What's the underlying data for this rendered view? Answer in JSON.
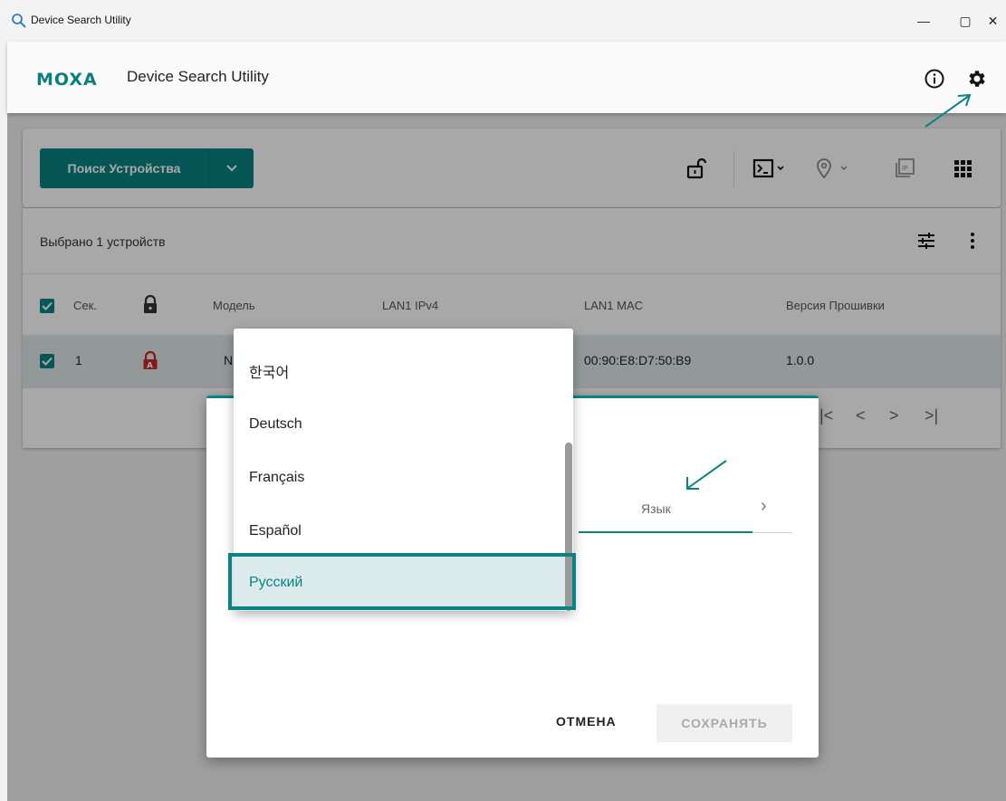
{
  "window": {
    "title": "Device Search Utility",
    "controls": {
      "minimize": "—",
      "maximize": "▢",
      "close": "✕"
    }
  },
  "header": {
    "logo": "MOXA",
    "title": "Device Search Utility"
  },
  "toolbar": {
    "search_label": "Поиск Устройства"
  },
  "table": {
    "selected_text": "Выбрано 1 устройств",
    "columns": [
      "Сек.",
      "Модель",
      "LAN1 IPv4",
      "LAN1 MAC",
      "Версия Прошивки"
    ],
    "rows": [
      {
        "sec": "1",
        "model": "N",
        "mac": "00:90:E8:D7:50:B9",
        "firmware": "1.0.0"
      }
    ],
    "pager": [
      "|<",
      "<",
      ">",
      ">|"
    ]
  },
  "dialog": {
    "language_label": "Язык",
    "cancel_label": "ОТМЕНА",
    "save_label": "СОХРАНЯТЬ"
  },
  "dropdown": {
    "options": [
      "한국어",
      "Deutsch",
      "Français",
      "Español",
      "Русский"
    ],
    "selected": "Русский"
  },
  "colors": {
    "accent": "#0b8383",
    "lock_red": "#c62828"
  }
}
